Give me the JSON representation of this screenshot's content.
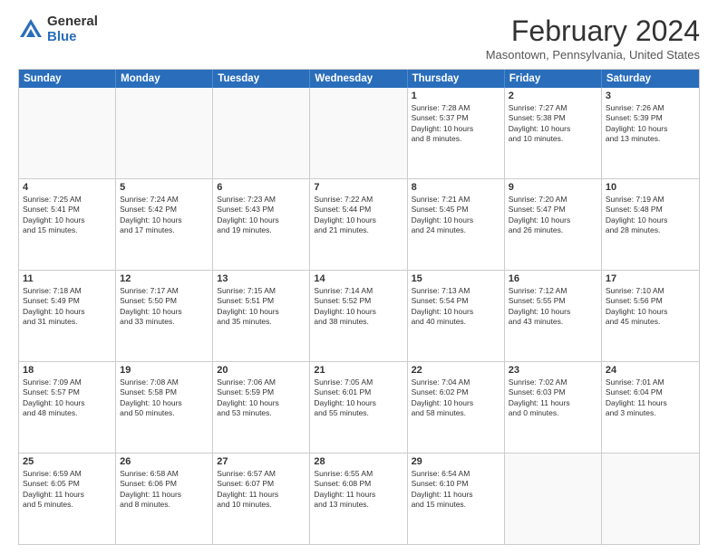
{
  "logo": {
    "general": "General",
    "blue": "Blue"
  },
  "title": "February 2024",
  "location": "Masontown, Pennsylvania, United States",
  "header_days": [
    "Sunday",
    "Monday",
    "Tuesday",
    "Wednesday",
    "Thursday",
    "Friday",
    "Saturday"
  ],
  "weeks": [
    [
      {
        "day": "",
        "text": ""
      },
      {
        "day": "",
        "text": ""
      },
      {
        "day": "",
        "text": ""
      },
      {
        "day": "",
        "text": ""
      },
      {
        "day": "1",
        "text": "Sunrise: 7:28 AM\nSunset: 5:37 PM\nDaylight: 10 hours\nand 8 minutes."
      },
      {
        "day": "2",
        "text": "Sunrise: 7:27 AM\nSunset: 5:38 PM\nDaylight: 10 hours\nand 10 minutes."
      },
      {
        "day": "3",
        "text": "Sunrise: 7:26 AM\nSunset: 5:39 PM\nDaylight: 10 hours\nand 13 minutes."
      }
    ],
    [
      {
        "day": "4",
        "text": "Sunrise: 7:25 AM\nSunset: 5:41 PM\nDaylight: 10 hours\nand 15 minutes."
      },
      {
        "day": "5",
        "text": "Sunrise: 7:24 AM\nSunset: 5:42 PM\nDaylight: 10 hours\nand 17 minutes."
      },
      {
        "day": "6",
        "text": "Sunrise: 7:23 AM\nSunset: 5:43 PM\nDaylight: 10 hours\nand 19 minutes."
      },
      {
        "day": "7",
        "text": "Sunrise: 7:22 AM\nSunset: 5:44 PM\nDaylight: 10 hours\nand 21 minutes."
      },
      {
        "day": "8",
        "text": "Sunrise: 7:21 AM\nSunset: 5:45 PM\nDaylight: 10 hours\nand 24 minutes."
      },
      {
        "day": "9",
        "text": "Sunrise: 7:20 AM\nSunset: 5:47 PM\nDaylight: 10 hours\nand 26 minutes."
      },
      {
        "day": "10",
        "text": "Sunrise: 7:19 AM\nSunset: 5:48 PM\nDaylight: 10 hours\nand 28 minutes."
      }
    ],
    [
      {
        "day": "11",
        "text": "Sunrise: 7:18 AM\nSunset: 5:49 PM\nDaylight: 10 hours\nand 31 minutes."
      },
      {
        "day": "12",
        "text": "Sunrise: 7:17 AM\nSunset: 5:50 PM\nDaylight: 10 hours\nand 33 minutes."
      },
      {
        "day": "13",
        "text": "Sunrise: 7:15 AM\nSunset: 5:51 PM\nDaylight: 10 hours\nand 35 minutes."
      },
      {
        "day": "14",
        "text": "Sunrise: 7:14 AM\nSunset: 5:52 PM\nDaylight: 10 hours\nand 38 minutes."
      },
      {
        "day": "15",
        "text": "Sunrise: 7:13 AM\nSunset: 5:54 PM\nDaylight: 10 hours\nand 40 minutes."
      },
      {
        "day": "16",
        "text": "Sunrise: 7:12 AM\nSunset: 5:55 PM\nDaylight: 10 hours\nand 43 minutes."
      },
      {
        "day": "17",
        "text": "Sunrise: 7:10 AM\nSunset: 5:56 PM\nDaylight: 10 hours\nand 45 minutes."
      }
    ],
    [
      {
        "day": "18",
        "text": "Sunrise: 7:09 AM\nSunset: 5:57 PM\nDaylight: 10 hours\nand 48 minutes."
      },
      {
        "day": "19",
        "text": "Sunrise: 7:08 AM\nSunset: 5:58 PM\nDaylight: 10 hours\nand 50 minutes."
      },
      {
        "day": "20",
        "text": "Sunrise: 7:06 AM\nSunset: 5:59 PM\nDaylight: 10 hours\nand 53 minutes."
      },
      {
        "day": "21",
        "text": "Sunrise: 7:05 AM\nSunset: 6:01 PM\nDaylight: 10 hours\nand 55 minutes."
      },
      {
        "day": "22",
        "text": "Sunrise: 7:04 AM\nSunset: 6:02 PM\nDaylight: 10 hours\nand 58 minutes."
      },
      {
        "day": "23",
        "text": "Sunrise: 7:02 AM\nSunset: 6:03 PM\nDaylight: 11 hours\nand 0 minutes."
      },
      {
        "day": "24",
        "text": "Sunrise: 7:01 AM\nSunset: 6:04 PM\nDaylight: 11 hours\nand 3 minutes."
      }
    ],
    [
      {
        "day": "25",
        "text": "Sunrise: 6:59 AM\nSunset: 6:05 PM\nDaylight: 11 hours\nand 5 minutes."
      },
      {
        "day": "26",
        "text": "Sunrise: 6:58 AM\nSunset: 6:06 PM\nDaylight: 11 hours\nand 8 minutes."
      },
      {
        "day": "27",
        "text": "Sunrise: 6:57 AM\nSunset: 6:07 PM\nDaylight: 11 hours\nand 10 minutes."
      },
      {
        "day": "28",
        "text": "Sunrise: 6:55 AM\nSunset: 6:08 PM\nDaylight: 11 hours\nand 13 minutes."
      },
      {
        "day": "29",
        "text": "Sunrise: 6:54 AM\nSunset: 6:10 PM\nDaylight: 11 hours\nand 15 minutes."
      },
      {
        "day": "",
        "text": ""
      },
      {
        "day": "",
        "text": ""
      }
    ]
  ]
}
